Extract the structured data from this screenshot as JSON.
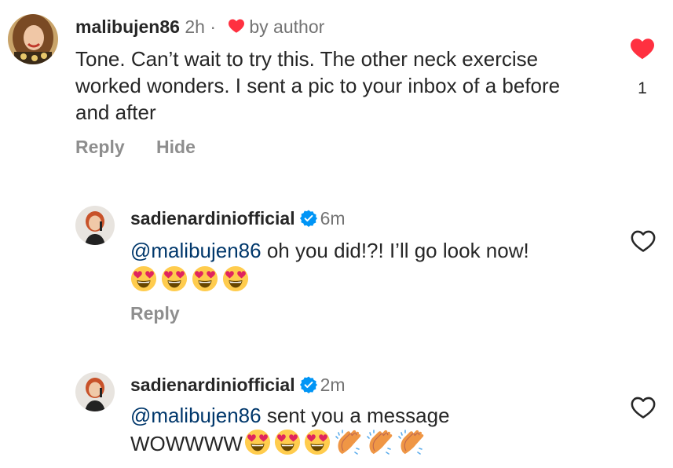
{
  "comments": [
    {
      "username": "malibujen86",
      "time": "2h",
      "separator": "·",
      "liked_by_author": "by author",
      "text": "Tone. Can’t wait to try this.  The other neck exercise worked wonders.  I sent a pic to your inbox of a before and after",
      "actions": {
        "reply": "Reply",
        "hide": "Hide"
      },
      "like_count": "1",
      "liked": true
    },
    {
      "username": "sadienardiniofficial",
      "time": "6m",
      "mention": "@malibujen86",
      "text": " oh you did!?! I’ll go look now!",
      "emojis": [
        "heart-eyes-emoji",
        "heart-eyes-emoji",
        "heart-eyes-emoji",
        "heart-eyes-emoji"
      ],
      "actions": {
        "reply": "Reply"
      },
      "liked": false
    },
    {
      "username": "sadienardiniofficial",
      "time": "2m",
      "mention": "@malibujen86",
      "text": " sent you a message",
      "text2": "WOWWWW",
      "emojis": [
        "heart-eyes-emoji",
        "heart-eyes-emoji",
        "heart-eyes-emoji",
        "clapping-hands-emoji",
        "clapping-hands-emoji",
        "clapping-hands-emoji"
      ],
      "liked": false
    }
  ],
  "colors": {
    "like_red": "#ff3040",
    "verified_blue": "#0095f6",
    "mention": "#00376b",
    "muted": "#737373"
  }
}
